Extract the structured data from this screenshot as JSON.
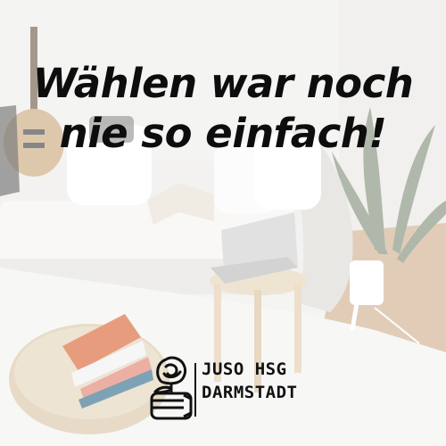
{
  "headline": {
    "line1": "Wählen war noch",
    "line2": "nie so einfach!"
  },
  "logo": {
    "icon": "rose-fist-icon",
    "line1": "JUSO HSG",
    "line2": "DARMSTADT"
  },
  "colors": {
    "text": "#0d0d0d",
    "wall": "#f1f0ee",
    "floor": "#c9a27a"
  }
}
